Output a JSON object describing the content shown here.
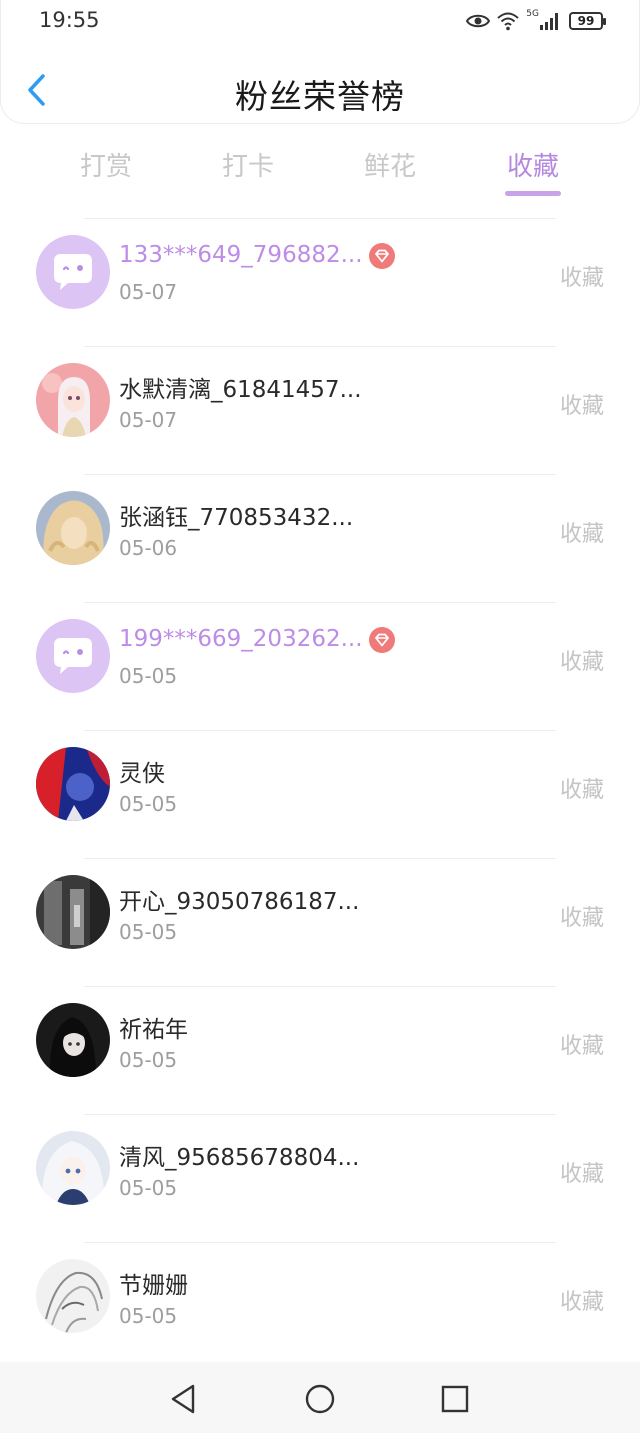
{
  "status_bar": {
    "time": "19:55",
    "network": "5G",
    "battery": "99"
  },
  "header": {
    "title": "粉丝荣誉榜"
  },
  "tabs": [
    {
      "label": "打赏"
    },
    {
      "label": "打卡"
    },
    {
      "label": "鲜花"
    },
    {
      "label": "收藏",
      "active": true
    }
  ],
  "rows": [
    {
      "name": "133***649_796882...",
      "date": "05-07",
      "action": "收藏",
      "vip": true,
      "avatar": "default-bubble"
    },
    {
      "name": "水默清漓_61841457...",
      "date": "05-07",
      "action": "收藏",
      "vip": false,
      "avatar": "anime-girl-pink"
    },
    {
      "name": "张涵钰_770853432...",
      "date": "05-06",
      "action": "收藏",
      "vip": false,
      "avatar": "blonde-hair"
    },
    {
      "name": "199***669_203262...",
      "date": "05-05",
      "action": "收藏",
      "vip": true,
      "avatar": "default-bubble"
    },
    {
      "name": "灵侠",
      "date": "05-05",
      "action": "收藏",
      "vip": false,
      "avatar": "red-blue-art"
    },
    {
      "name": "开心_93050786187...",
      "date": "05-05",
      "action": "收藏",
      "vip": false,
      "avatar": "dark-street"
    },
    {
      "name": "祈祐年",
      "date": "05-05",
      "action": "收藏",
      "vip": false,
      "avatar": "dark-anime"
    },
    {
      "name": "清风_95685678804...",
      "date": "05-05",
      "action": "收藏",
      "vip": false,
      "avatar": "white-hair-anime"
    },
    {
      "name": "节姗姗",
      "date": "05-05",
      "action": "收藏",
      "vip": false,
      "avatar": "sketch-gray"
    }
  ],
  "colors": {
    "accent": "#b589e0",
    "vip_name": "#bd8ce6",
    "vip_badge": "#f07a7a",
    "default_avatar_bg": "#dcc5f5"
  },
  "icons": {
    "back": "chevron-left-icon",
    "eye": "eye-icon",
    "wifi": "wifi-icon",
    "signal": "signal-icon",
    "battery": "battery-icon",
    "vip": "diamond-icon",
    "nav_back": "triangle-back-icon",
    "nav_home": "circle-home-icon",
    "nav_recent": "square-recent-icon"
  }
}
